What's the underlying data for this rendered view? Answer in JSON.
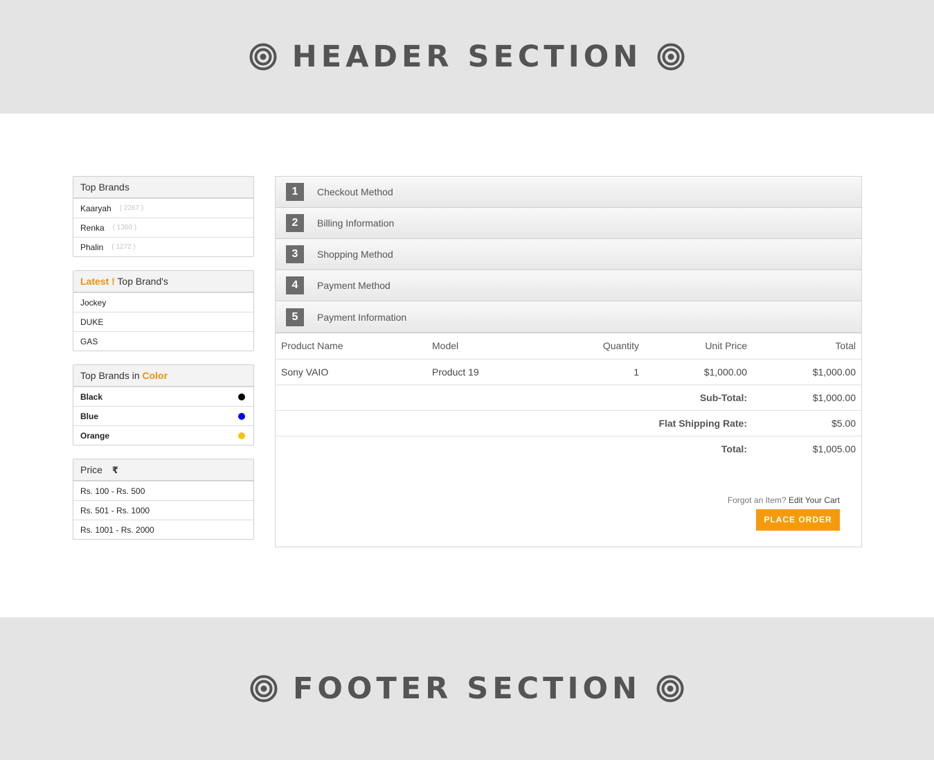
{
  "header": {
    "title": "HEADER SECTION"
  },
  "footer": {
    "title": "FOOTER SECTION"
  },
  "sidebar": {
    "top_brands": {
      "title": "Top Brands",
      "items": [
        {
          "name": "Kaaryah",
          "count": "( 2267 )"
        },
        {
          "name": "Renka",
          "count": "( 1360 )"
        },
        {
          "name": "Phalin",
          "count": "( 1272 )"
        }
      ]
    },
    "latest_brands": {
      "title_accent": "Latest !",
      "title_rest": " Top Brand's",
      "items": [
        "Jockey",
        "DUKE",
        "GAS"
      ]
    },
    "color_brands": {
      "title_rest": "Top Brands in ",
      "title_accent": "Color",
      "items": [
        {
          "name": "Black",
          "color": "#000000"
        },
        {
          "name": "Blue",
          "color": "#0000ee"
        },
        {
          "name": "Orange",
          "color": "#f5c400"
        }
      ]
    },
    "price": {
      "title": "Price",
      "icon": "rupee-icon",
      "symbol": "₹",
      "items": [
        "Rs. 100 - Rs. 500",
        "Rs. 501 - Rs. 1000",
        "Rs. 1001 - Rs. 2000"
      ]
    }
  },
  "steps": [
    {
      "num": "1",
      "label": "Checkout Method"
    },
    {
      "num": "2",
      "label": "Billing Information"
    },
    {
      "num": "3",
      "label": "Shopping Method"
    },
    {
      "num": "4",
      "label": "Payment Method"
    },
    {
      "num": "5",
      "label": "Payment Information"
    }
  ],
  "cart": {
    "columns": {
      "name": "Product Name",
      "model": "Model",
      "qty": "Quantity",
      "unit": "Unit Price",
      "total": "Total"
    },
    "row": {
      "name": "Sony VAIO",
      "model": "Product 19",
      "qty": "1",
      "unit": "$1,000.00",
      "total": "$1,000.00"
    },
    "subtotal": {
      "label": "Sub-Total:",
      "value": "$1,000.00"
    },
    "shipping": {
      "label": "Flat Shipping Rate:",
      "value": "$5.00"
    },
    "grand_total": {
      "label": "Total:",
      "value": "$1,005.00"
    },
    "forgot_text": "Forgot an Item?",
    "edit_cart": "Edit Your Cart",
    "place_order": "PLACE ORDER"
  },
  "colors": {
    "accent": "#f0900f",
    "button": "#f59b0b",
    "band": "#e4e4e4"
  }
}
